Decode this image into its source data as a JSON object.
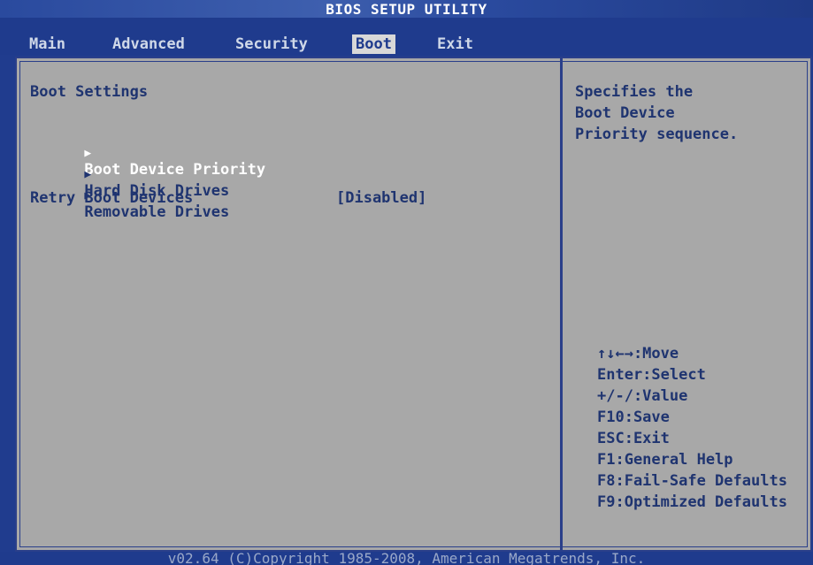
{
  "title": "BIOS SETUP UTILITY",
  "menu": {
    "tabs": [
      {
        "label": "Main"
      },
      {
        "label": "Advanced"
      },
      {
        "label": "Security"
      },
      {
        "label": "Boot"
      },
      {
        "label": "Exit"
      }
    ],
    "active": "Boot"
  },
  "boot": {
    "section_title": "Boot Settings",
    "items": [
      {
        "label": "Boot Device Priority",
        "highlighted": true
      },
      {
        "label": "Hard Disk Drives"
      },
      {
        "label": "Removable Drives"
      }
    ],
    "retry": {
      "label": "Retry Boot Devices",
      "value": "[Disabled]"
    },
    "arrow_icon": "right-triangle-icon"
  },
  "help": {
    "description": [
      "Specifies the",
      "Boot Device",
      "Priority sequence."
    ],
    "keys": [
      "↑↓←→:Move",
      "Enter:Select",
      "+/-/:Value",
      "F10:Save",
      "ESC:Exit",
      "F1:General Help",
      "F8:Fail-Safe Defaults",
      "F9:Optimized Defaults"
    ]
  },
  "footer": "v02.64 (C)Copyright 1985-2008, American Megatrends, Inc.",
  "colors": {
    "background": "#1f3b8d",
    "panel": "#a8a8a8",
    "text": "#1f3470",
    "highlight": "#ffffff"
  }
}
